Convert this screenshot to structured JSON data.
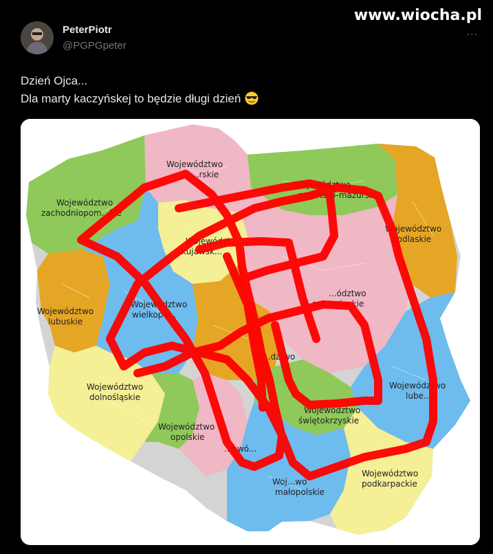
{
  "watermark": "www.wiocha.pl",
  "tweet": {
    "display_name": "PeterPiotr",
    "handle": "@PGPGpeter",
    "line1": "Dzień Ojca...",
    "line2": "Dla marty kaczyńskej to będzie długi dzień",
    "emoji": "smiling-face-with-sunglasses-icon",
    "more": "..."
  },
  "map": {
    "labels": {
      "pomorskie": [
        "Województwo",
        "...rskie"
      ],
      "zachodniopomorskie": [
        "Województwo",
        "zachodniopom...kie"
      ],
      "warminsko": [
        "Województwo",
        "...armińsko-mazurs..."
      ],
      "podlaskie": [
        "Województwo",
        "podlaskie"
      ],
      "kujawsko": [
        "Województ...",
        "kujawsk..."
      ],
      "lubuskie": [
        "Województwo",
        "lubuskie"
      ],
      "wielkopolskie": [
        "Województwo",
        "wielkopo..."
      ],
      "mazowieckie": [
        "...ództwo",
        "ma...wieckie"
      ],
      "lodzkie": [
        "...dztwo"
      ],
      "dolnoslaskie": [
        "Województwo",
        "dolnośląskie"
      ],
      "lubelskie": [
        "Województwo",
        "lube...e"
      ],
      "opolskie": [
        "Województwo",
        "opolskie"
      ],
      "swietokrzyskie": [
        "Województwo",
        "świętokrzyskie"
      ],
      "slaskie": [
        "...ewó..."
      ],
      "malopolskie": [
        "Woj...wo",
        "małopolskie"
      ],
      "podkarpackie": [
        "Województwo",
        "podkarpackie"
      ]
    },
    "colors": {
      "green": "#8ec95a",
      "pink": "#f0b7c4",
      "orange": "#e5a626",
      "yellow": "#f5ef96",
      "blue": "#6ebbee",
      "doodle": "#ff0000"
    }
  }
}
